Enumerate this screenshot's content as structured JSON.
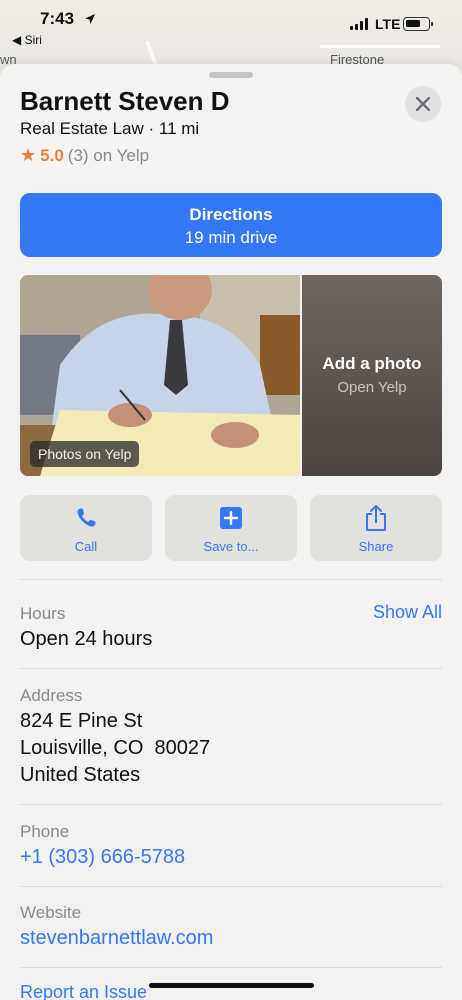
{
  "status": {
    "time": "7:43",
    "back_label": "◀ Siri",
    "network": "LTE"
  },
  "map": {
    "label_left": "wn",
    "label_right": "Firestone"
  },
  "place": {
    "name": "Barnett Steven D",
    "subtitle": "Real Estate Law · 11 mi",
    "rating_score": "5.0",
    "rating_rest": "(3) on Yelp",
    "star_glyph": "★"
  },
  "directions": {
    "label": "Directions",
    "eta": "19 min drive"
  },
  "photos": {
    "badge": "Photos on Yelp",
    "add_title": "Add a photo",
    "add_sub": "Open Yelp"
  },
  "actions": [
    {
      "label": "Call",
      "icon": "phone-icon"
    },
    {
      "label": "Save to...",
      "icon": "plus-square-icon"
    },
    {
      "label": "Share",
      "icon": "share-icon"
    }
  ],
  "hours": {
    "label": "Hours",
    "value": "Open 24 hours",
    "show_all": "Show All"
  },
  "address": {
    "label": "Address",
    "line1": "824 E Pine St",
    "line2": "Louisville, CO  80027",
    "line3": "United States"
  },
  "phone": {
    "label": "Phone",
    "value": "+1 (303) 666-5788"
  },
  "website": {
    "label": "Website",
    "value": "stevenbarnettlaw.com"
  },
  "report": {
    "label": "Report an Issue"
  },
  "colors": {
    "accent": "#3478f6",
    "star": "#e8813a"
  }
}
